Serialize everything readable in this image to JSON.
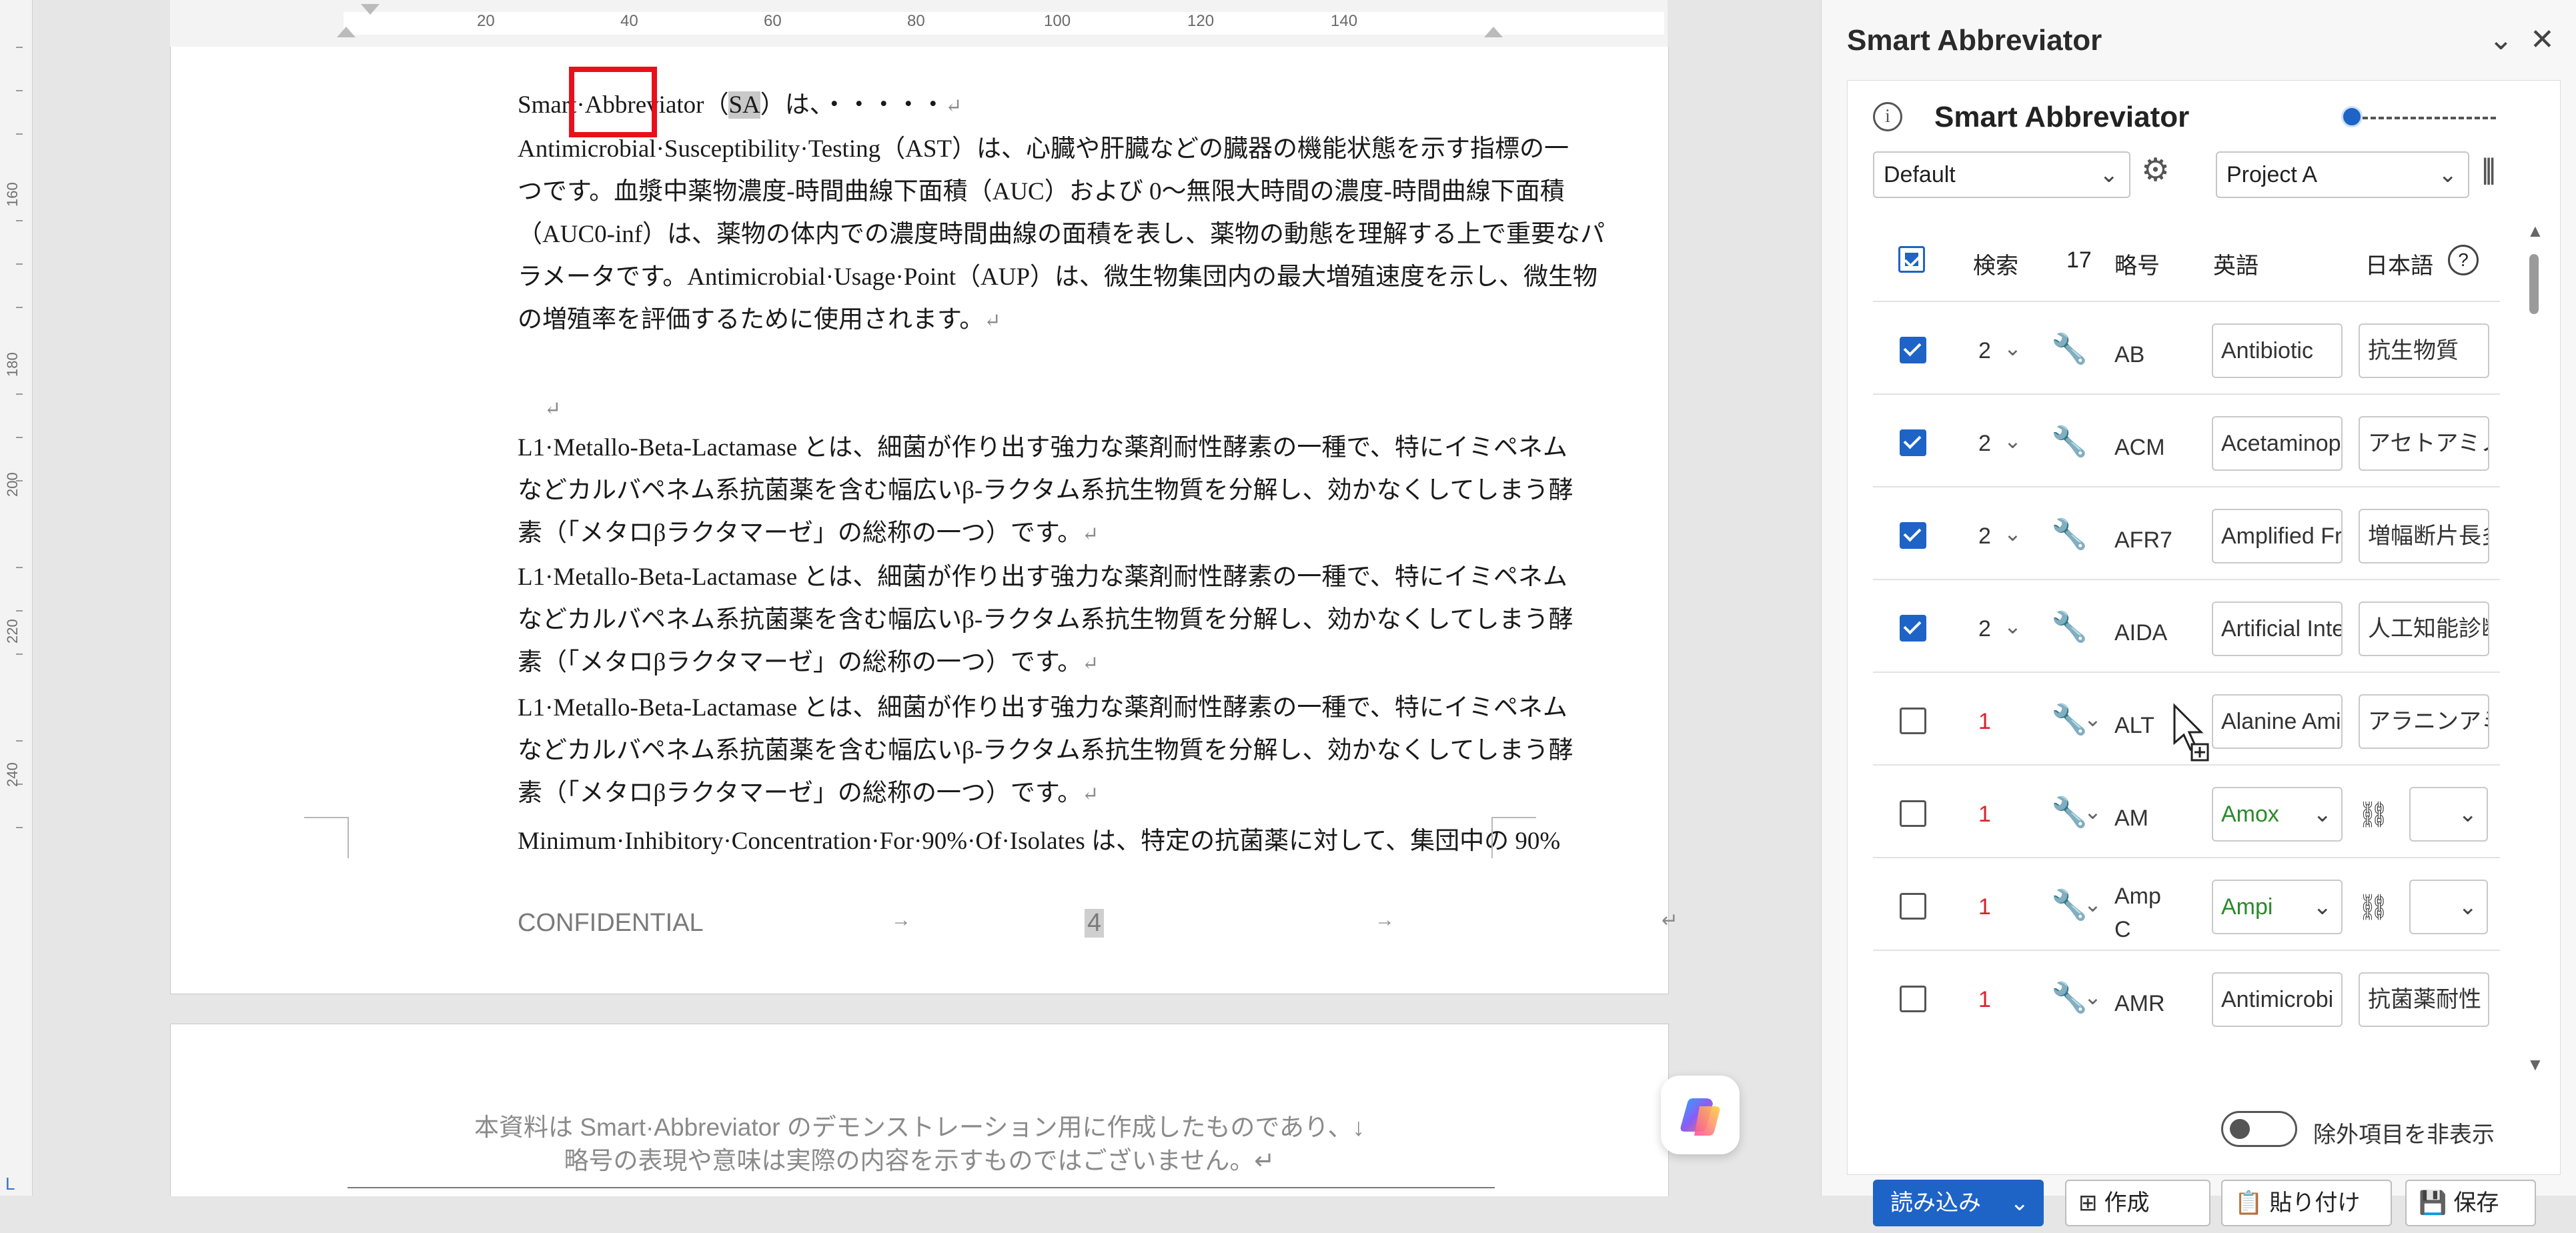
{
  "vruler": {
    "numbers": [
      "160",
      "180",
      "200",
      "220",
      "240"
    ],
    "corner_mark": "L"
  },
  "hruler": {
    "numbers": [
      "20",
      "40",
      "60",
      "80",
      "100",
      "120",
      "140"
    ]
  },
  "document": {
    "page1": {
      "line1": {
        "before": "Smart·Abbreviator（",
        "highlight": "SA",
        "after": "）は、・・・・・",
        "mark": "↵"
      },
      "para_ast": {
        "lines": [
          "Antimicrobial·Susceptibility·Testing（AST）は、心臓や肝臓などの臓器の機能状態を示す指標の一",
          "つです。血漿中薬物濃度-時間曲線下面積（AUC）および 0〜無限大時間の濃度-時間曲線下面積",
          "（AUC0-inf）は、薬物の体内での濃度時間曲線の面積を表し、薬物の動態を理解する上で重要なパ",
          "ラメータです。Antimicrobial·Usage·Point（AUP）は、微生物集団内の最大増殖速度を示し、微生物",
          "の増殖率を評価するために使用されます。"
        ],
        "mark": "↵"
      },
      "blank_mark": "↵",
      "para_l1": {
        "lines": [
          "L1·Metallo-Beta-Lactamase とは、細菌が作り出す強力な薬剤耐性酵素の一種で、特にイミペネム",
          "などカルバペネム系抗菌薬を含む幅広いβ-ラクタム系抗生物質を分解し、効かなくしてしまう酵",
          "素（「メタロβラクタマーゼ」の総称の一つ）です。"
        ],
        "mark": "↵"
      },
      "para_mic": "Minimum·Inhibitory·Concentration·For·90%·Of·Isolates は、特定の抗菌薬に対して、集団中の 90%",
      "footer": {
        "left": "CONFIDENTIAL",
        "arrow": "→",
        "page": "4",
        "mark": "↵"
      }
    },
    "page2": {
      "line1": "本資料は Smart·Abbreviator のデモンストレーション用に作成したものであり、↓",
      "line2": "略号の表現や意味は実際の内容を示すものではございません。↵"
    }
  },
  "panel": {
    "title": "Smart Abbreviator",
    "collapse_icon": "chevron-down",
    "close_icon": "close",
    "inner_title": "Smart Abbreviator",
    "profile_select": "Default",
    "project_select": "Project A",
    "table": {
      "headers": {
        "search": "検索",
        "count": "17",
        "abbr": "略号",
        "english": "英語",
        "japanese": "日本語",
        "help": "?"
      },
      "rows": [
        {
          "checked": true,
          "count": "2",
          "red": false,
          "abbr": [
            "AB"
          ],
          "en": "Antibiotic",
          "ja": "抗生物質",
          "type": "text"
        },
        {
          "checked": true,
          "count": "2",
          "red": false,
          "abbr": [
            "ACM"
          ],
          "en": "Acetaminop",
          "ja": "アセトアミノ",
          "type": "text"
        },
        {
          "checked": true,
          "count": "2",
          "red": false,
          "abbr": [
            "AFR7"
          ],
          "en": "Amplified Fr",
          "ja": "増幅断片長多",
          "type": "text"
        },
        {
          "checked": true,
          "count": "2",
          "red": false,
          "abbr": [
            "AIDA"
          ],
          "en": "Artificial Inte",
          "ja": "人工知能診断",
          "type": "text"
        },
        {
          "checked": false,
          "count": "1",
          "red": true,
          "abbr": [
            "ALT"
          ],
          "en": "Alanine Ami",
          "ja": "アラニンアミ",
          "type": "text"
        },
        {
          "checked": false,
          "count": "1",
          "red": true,
          "abbr": [
            "AM"
          ],
          "en": "Amox",
          "ja": "",
          "type": "select"
        },
        {
          "checked": false,
          "count": "1",
          "red": true,
          "abbr": [
            "Amp",
            "C"
          ],
          "en": "Ampi",
          "ja": "",
          "type": "select"
        },
        {
          "checked": false,
          "count": "1",
          "red": true,
          "abbr": [
            "AMR"
          ],
          "en": "Antimicrobi",
          "ja": "抗菌薬耐性",
          "type": "text"
        }
      ]
    },
    "toggle_label": "除外項目を非表示",
    "buttons": {
      "load": "読み込み",
      "create": "作成",
      "paste": "貼り付け",
      "save": "保存"
    }
  },
  "colors": {
    "accent": "#1e63c6",
    "red": "#d8232a",
    "highlight_box": "#e8101a",
    "green_text": "#2a8a2a"
  }
}
